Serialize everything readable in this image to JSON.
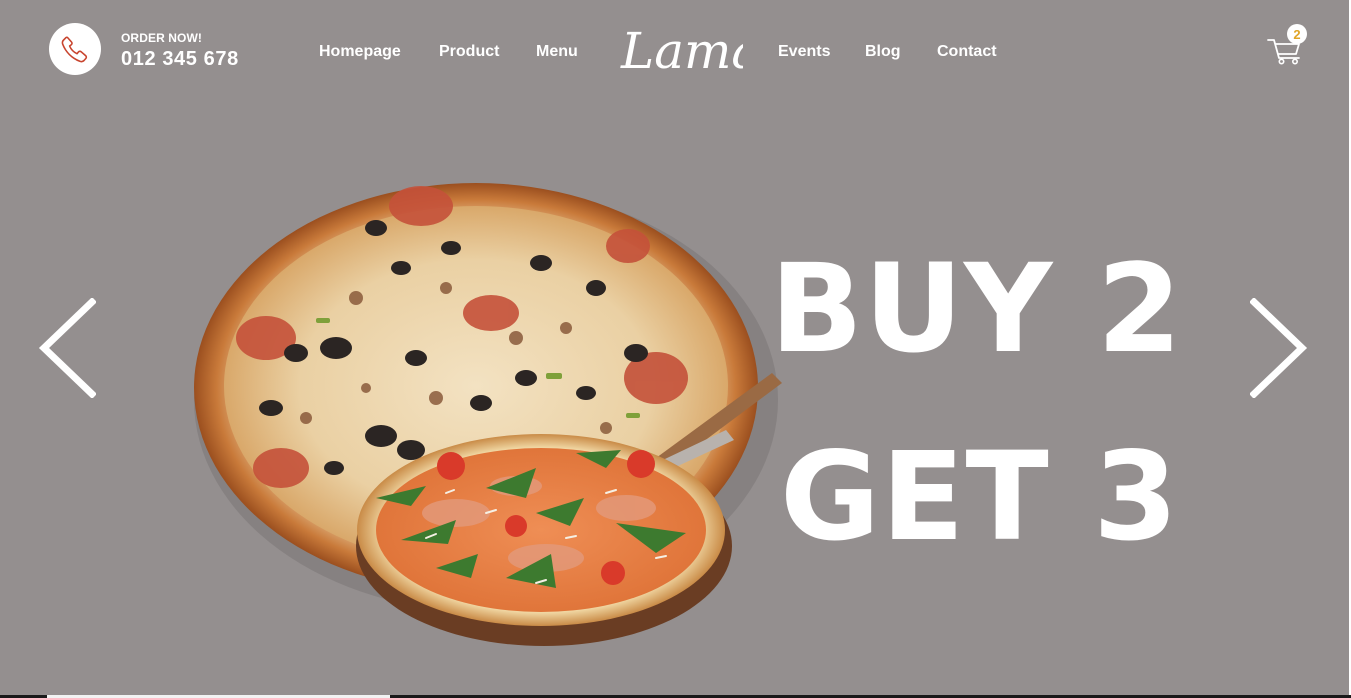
{
  "header": {
    "order_label": "ORDER NOW!",
    "phone": "012 345 678",
    "logo_text": "Lama",
    "nav_left": [
      "Homepage",
      "Product",
      "Menu"
    ],
    "nav_right": [
      "Events",
      "Blog",
      "Contact"
    ],
    "cart_count": "2",
    "icons": {
      "phone": "phone-icon",
      "cart": "cart-icon"
    }
  },
  "hero": {
    "line1": "BUY 2",
    "line2": "GET 3",
    "prev_icon": "chevron-left-icon",
    "next_icon": "chevron-right-icon",
    "image": "pizza-image"
  },
  "colors": {
    "background": "#948f8f",
    "text": "#ffffff",
    "phone_icon": "#c8452f",
    "cart_badge_text": "#e0a526"
  }
}
